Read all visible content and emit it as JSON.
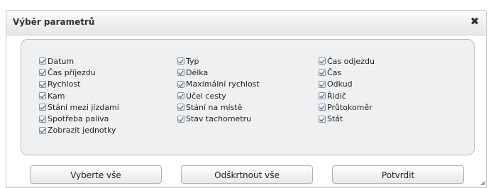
{
  "dialog": {
    "title": "Výběr parametrů",
    "close_glyph": "✖"
  },
  "columns": [
    [
      "Datum",
      "Čas příjezdu",
      "Rychlost",
      "Kam",
      "Stání mezi jízdami",
      "Spotřeba paliva",
      "Zobrazit jednotky"
    ],
    [
      "Typ",
      "Délka",
      "Maximální rychlost",
      "Účel cesty",
      "Stání na místě",
      "Stav tachometru"
    ],
    [
      "Čas odjezdu",
      "Čas",
      "Odkud",
      "Řidič",
      "Průtokoměr",
      "Stát"
    ]
  ],
  "buttons": {
    "select_all": "Vyberte vše",
    "deselect_all": "Odškrtnout vše",
    "confirm": "Potvrdit"
  },
  "colors": {
    "panel": "#eef0f2",
    "check": "#2a4c8a"
  }
}
